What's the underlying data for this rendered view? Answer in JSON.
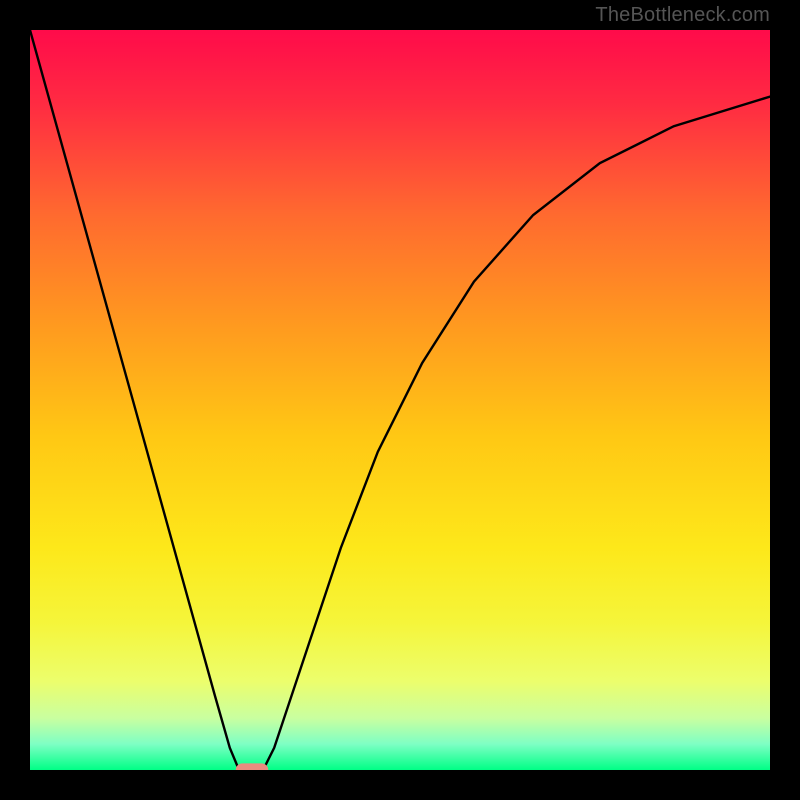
{
  "watermark": "TheBottleneck.com",
  "chart_data": {
    "type": "line",
    "title": "",
    "xlabel": "",
    "ylabel": "",
    "xlim": [
      0,
      100
    ],
    "ylim": [
      0,
      100
    ],
    "grid": false,
    "legend": false,
    "background_gradient": {
      "stops": [
        {
          "offset": 0.0,
          "color": "#ff0b4a"
        },
        {
          "offset": 0.1,
          "color": "#ff2b42"
        },
        {
          "offset": 0.25,
          "color": "#ff6a2f"
        },
        {
          "offset": 0.4,
          "color": "#ff9a1f"
        },
        {
          "offset": 0.55,
          "color": "#ffc814"
        },
        {
          "offset": 0.7,
          "color": "#fde81a"
        },
        {
          "offset": 0.8,
          "color": "#f5f53a"
        },
        {
          "offset": 0.88,
          "color": "#ecfe6c"
        },
        {
          "offset": 0.93,
          "color": "#c9ffa0"
        },
        {
          "offset": 0.965,
          "color": "#7effc4"
        },
        {
          "offset": 1.0,
          "color": "#00ff86"
        }
      ]
    },
    "series": [
      {
        "name": "left-branch",
        "color": "#000000",
        "x": [
          0,
          5,
          10,
          15,
          20,
          25,
          27,
          28,
          28.5
        ],
        "y": [
          100,
          82,
          64,
          46,
          28,
          10,
          3,
          0.6,
          0
        ]
      },
      {
        "name": "right-branch",
        "color": "#000000",
        "x": [
          31.5,
          33,
          35,
          38,
          42,
          47,
          53,
          60,
          68,
          77,
          87,
          100
        ],
        "y": [
          0,
          3,
          9,
          18,
          30,
          43,
          55,
          66,
          75,
          82,
          87,
          91
        ]
      }
    ],
    "marker": {
      "shape": "pill",
      "center_x": 30,
      "center_y": 0,
      "width": 4.4,
      "height": 1.8,
      "color": "#e98b7f"
    }
  }
}
